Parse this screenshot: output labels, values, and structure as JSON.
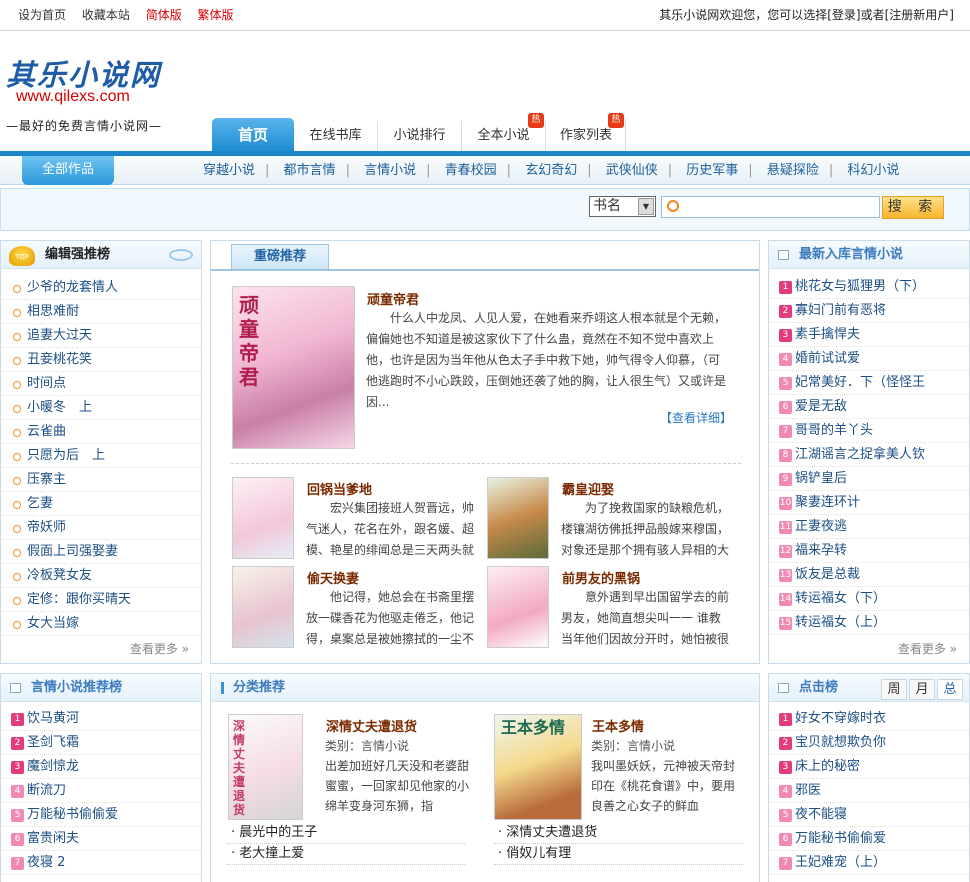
{
  "topbar": {
    "set_home": "设为首页",
    "bookmark": "收藏本站",
    "simplified": "简体版",
    "traditional": "繁体版",
    "welcome": "其乐小说网欢迎您，您可以选择",
    "login": "[登录]",
    "or": "或者",
    "register": "[注册新用户]"
  },
  "logo": {
    "name": "其乐小说网",
    "url": "www.qilexs.com",
    "slogan": "—最好的免费言情小说网—"
  },
  "nav": {
    "home": "首页",
    "items": [
      "在线书库",
      "小说排行",
      "全本小说",
      "作家列表"
    ],
    "hot_label": "热"
  },
  "subnav": {
    "all": "全部作品",
    "cats": [
      "穿越小说",
      "都市言情",
      "言情小说",
      "青春校园",
      "玄幻奇幻",
      "武侠仙侠",
      "历史军事",
      "悬疑探险",
      "科幻小说"
    ]
  },
  "search": {
    "select_value": "书名",
    "button": "搜 索"
  },
  "left_panel": {
    "title": "编辑强推榜",
    "items": [
      "少爷的龙套情人",
      "相思难耐",
      "追妻大过天",
      "丑妾桃花笑",
      "时间点",
      "小暖冬　上",
      "云雀曲",
      "只愿为后　上",
      "压寨主",
      "乞妻",
      "帝妖师",
      "假面上司强娶妻",
      "冷板凳女友",
      "定修：跟你买晴天",
      "女大当嫁"
    ],
    "more": "查看更多"
  },
  "featured": {
    "tab": "重磅推荐",
    "main": {
      "title": "顽童帝君",
      "cover_title": "顽童帝君",
      "desc": "　　什么人中龙凤、人见人爱，在她看来乔翊这人根本就是个无赖，偏偏她也不知道是被这家伙下了什么蛊，竟然在不知不觉中喜欢上他，也许是因为当年他从色太子手中救下她，帅气得令人仰慕，（可他逃跑时不小心跌跤，压倒她还袭了她的胸，让人很生气）又或许是因...",
      "detail": "【查看详细】"
    },
    "books": [
      {
        "title": "回锅当爹地",
        "desc": "　　宏兴集团接班人贺晋远，帅气迷人，花名在外，跟名媛、超模、艳星的绯闻总是三天两头就"
      },
      {
        "title": "霸皇迎娶",
        "desc": "　　为了挽救国家的缺粮危机，楼镶湖彷佛抵押品般嫁来穆国，对象还是那个拥有骇人异相的大"
      },
      {
        "title": "偷天换妻",
        "desc": "　　他记得，她总会在书斋里摆放一碟香花为他驱走倦乏，他记得，桌案总是被她擦拭的一尘不"
      },
      {
        "title": "前男友的黑锅",
        "desc": "　　意外遇到早出国留学去的前男友，她简直想尖叫一一 谁教当年他们因故分开时，她怕被很"
      }
    ]
  },
  "right_panel": {
    "title": "最新入库言情小说",
    "items": [
      "桃花女与狐狸男（下）",
      "寡妇门前有恶将",
      "素手擒悍夫",
      "婚前试试爱",
      "妃常美好．下（怪怪王",
      "爱是无敌",
      "哥哥的羊丫头",
      "江湖谣言之捉拿美人钦",
      "锅铲皇后",
      "聚妻连环计",
      "正妻夜逃",
      "福来孕转",
      "饭友是总裁",
      "转运福女（下）",
      "转运福女（上）"
    ],
    "more": "查看更多"
  },
  "bottom_left": {
    "title": "言情小说推荐榜",
    "items": [
      "饮马黄河",
      "圣剑飞霜",
      "魔剑惊龙",
      "断流刀",
      "万能秘书偷偷爱",
      "富贵闲夫",
      "夜寝 2"
    ]
  },
  "category": {
    "title": "分类推荐",
    "books": [
      {
        "title": "深情丈夫遭退货",
        "category": "类别：言情小说",
        "desc": "出差加班好几天没和老婆甜蜜蜜，一回家却见他家的小绵羊变身河东狮，指",
        "cover_title": "深情丈夫遭退货",
        "links": [
          "晨光中的王子",
          "老大撞上爱"
        ]
      },
      {
        "title": "王本多情",
        "category": "类别：言情小说",
        "desc": "我叫墨妖妖，元神被天帝封印在《桃花食谱》中，要用良善之心女子的鲜血",
        "cover_title": "王本多情",
        "links": [
          "深情丈夫遭退货",
          "俏奴儿有理"
        ]
      }
    ]
  },
  "click_panel": {
    "title": "点击榜",
    "tabs": [
      "周",
      "月",
      "总"
    ],
    "items": [
      "好女不穿嫁时衣",
      "宝贝就想欺负你",
      "床上的秘密",
      "邪医",
      "夜不能寝",
      "万能秘书偷偷爱",
      "王妃难宠（上）"
    ]
  },
  "colors": {
    "accent": "#1c86cc",
    "title_blue": "#3c7bbf",
    "book_title": "#7a2a00",
    "red": "#d00000"
  }
}
